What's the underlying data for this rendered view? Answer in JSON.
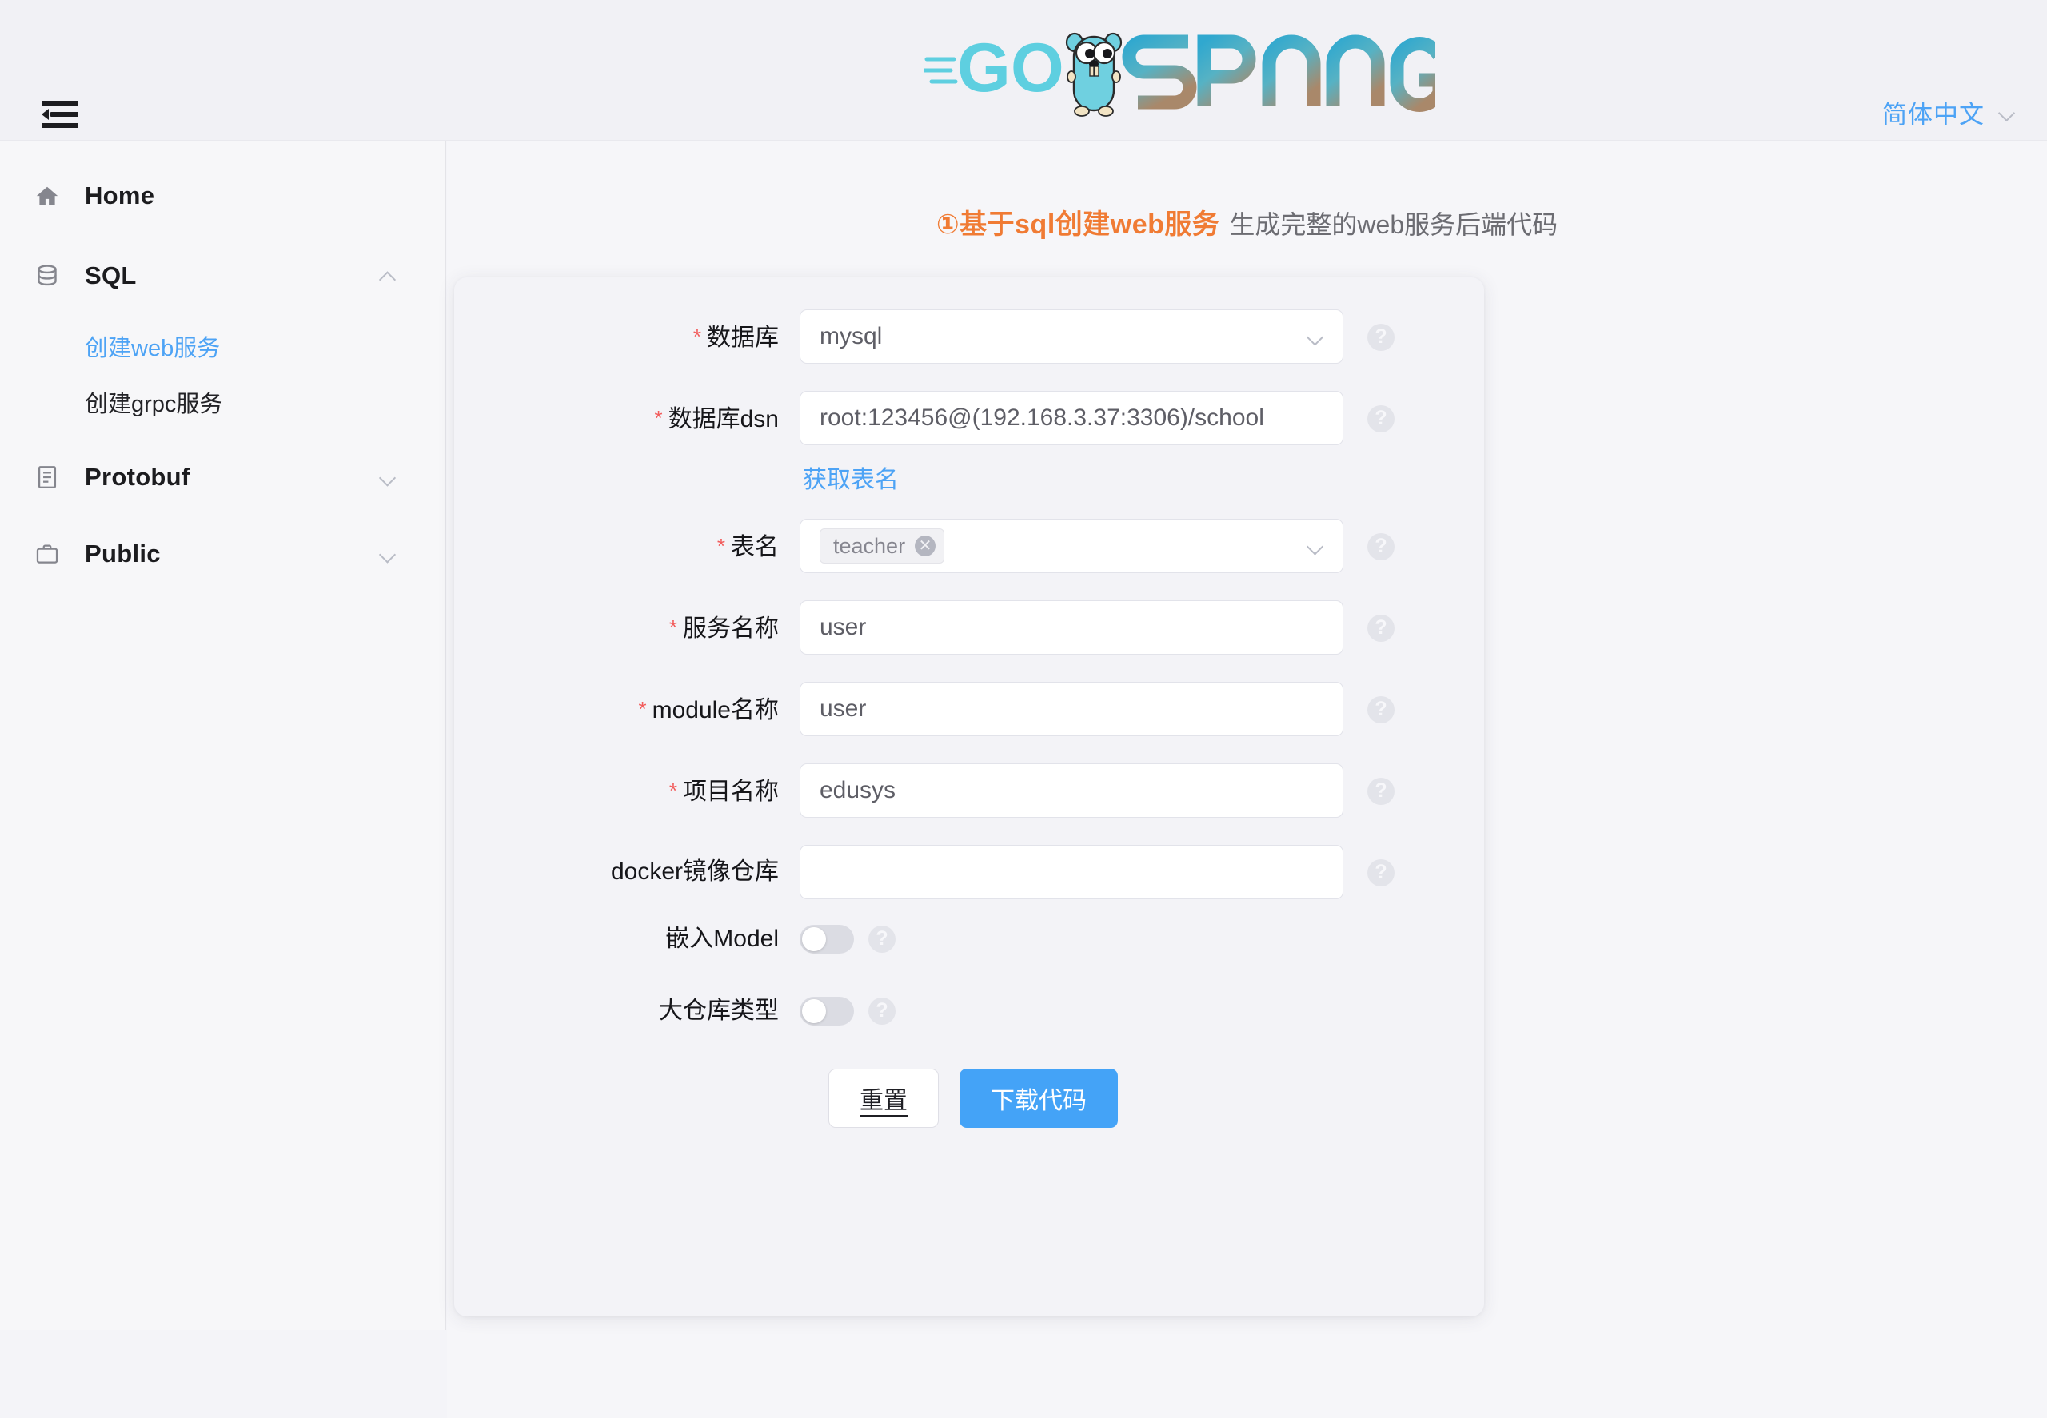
{
  "header": {
    "menu_toggle": "collapse-menu",
    "logo_text_go": "GO",
    "logo_text_sponge": "SPONGE",
    "language": "简体中文"
  },
  "sidebar": {
    "items": [
      {
        "id": "home",
        "label": "Home",
        "icon": "home-icon",
        "expandable": false
      },
      {
        "id": "sql",
        "label": "SQL",
        "icon": "database-icon",
        "expandable": true,
        "expanded": true
      },
      {
        "id": "protobuf",
        "label": "Protobuf",
        "icon": "document-icon",
        "expandable": true,
        "expanded": false
      },
      {
        "id": "public",
        "label": "Public",
        "icon": "briefcase-icon",
        "expandable": true,
        "expanded": false
      }
    ],
    "sql_children": [
      {
        "id": "create-web-service",
        "label": "创建web服务",
        "active": true
      },
      {
        "id": "create-grpc-service",
        "label": "创建grpc服务",
        "active": false
      }
    ]
  },
  "main": {
    "title_main": "①基于sql创建web服务",
    "title_sub": "生成完整的web服务后端代码",
    "form": {
      "fields": [
        {
          "id": "database",
          "label": "数据库",
          "required": true,
          "type": "select",
          "value": "mysql",
          "help": "?"
        },
        {
          "id": "database-dsn",
          "label": "数据库dsn",
          "required": true,
          "type": "text",
          "value": "root:123456@(192.168.3.37:3306)/school",
          "placeholder": "",
          "help": "?"
        },
        {
          "id": "table-name",
          "label": "表名",
          "required": true,
          "type": "multiselect",
          "tags": [
            "teacher"
          ],
          "help": "?"
        },
        {
          "id": "service-name",
          "label": "服务名称",
          "required": true,
          "type": "text",
          "value": "user",
          "placeholder": "",
          "help": "?"
        },
        {
          "id": "module-name",
          "label": "module名称",
          "required": true,
          "type": "text",
          "value": "user",
          "placeholder": "",
          "help": "?"
        },
        {
          "id": "project-name",
          "label": "项目名称",
          "required": true,
          "type": "text",
          "value": "edusys",
          "placeholder": "",
          "help": "?"
        },
        {
          "id": "docker-image-repo",
          "label": "docker镜像仓库",
          "required": false,
          "type": "text",
          "value": "",
          "placeholder": "",
          "help": "?"
        },
        {
          "id": "embed-model",
          "label": "嵌入Model",
          "required": false,
          "type": "switch",
          "checked": false,
          "help": "?"
        },
        {
          "id": "mono-repo-type",
          "label": "大仓库类型",
          "required": false,
          "type": "switch",
          "checked": false,
          "help": "?"
        }
      ],
      "get_table_link": "获取表名",
      "reset_button": "重置",
      "download_button": "下载代码"
    }
  },
  "colors": {
    "accent_blue": "#4da3f5",
    "primary_button": "#44a3f7",
    "title_orange": "#f07b34",
    "required_star": "#f25c5c",
    "page_bg": "#f6f6f9",
    "card_bg": "#f3f3f7",
    "sidebar_bg": "#f7f7f9",
    "header_bg": "#f1f1f5"
  }
}
